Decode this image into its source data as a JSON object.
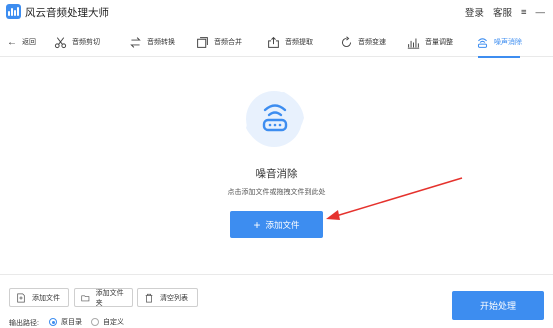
{
  "app": {
    "title": "风云音频处理大师"
  },
  "titlebar": {
    "login": "登录",
    "service": "客服",
    "menu_glyph": "≡",
    "minimize_glyph": "—"
  },
  "toolbar": {
    "back": "返回",
    "items": [
      {
        "label": "音频剪切",
        "icon": "scissors-icon"
      },
      {
        "label": "音频转换",
        "icon": "convert-icon"
      },
      {
        "label": "音频合并",
        "icon": "merge-icon"
      },
      {
        "label": "音频提取",
        "icon": "extract-icon"
      },
      {
        "label": "音频变速",
        "icon": "speed-icon"
      },
      {
        "label": "音量调整",
        "icon": "volume-icon"
      },
      {
        "label": "噪声消除",
        "icon": "denoise-icon",
        "active": true
      }
    ]
  },
  "main": {
    "title": "噪音消除",
    "subtitle": "点击添加文件或拖拽文件到此处",
    "add_button": "添加文件",
    "add_plus": "+"
  },
  "bottom": {
    "add_file": "添加文件",
    "add_folder": "添加文件夹",
    "clear_list": "清空列表",
    "output_label": "输出路径:",
    "option_original": "原目录",
    "option_custom": "自定义",
    "start": "开始处理"
  },
  "colors": {
    "accent": "#3d8df0",
    "arrow": "#e5322d",
    "hero_bg": "#e8f1fd"
  }
}
